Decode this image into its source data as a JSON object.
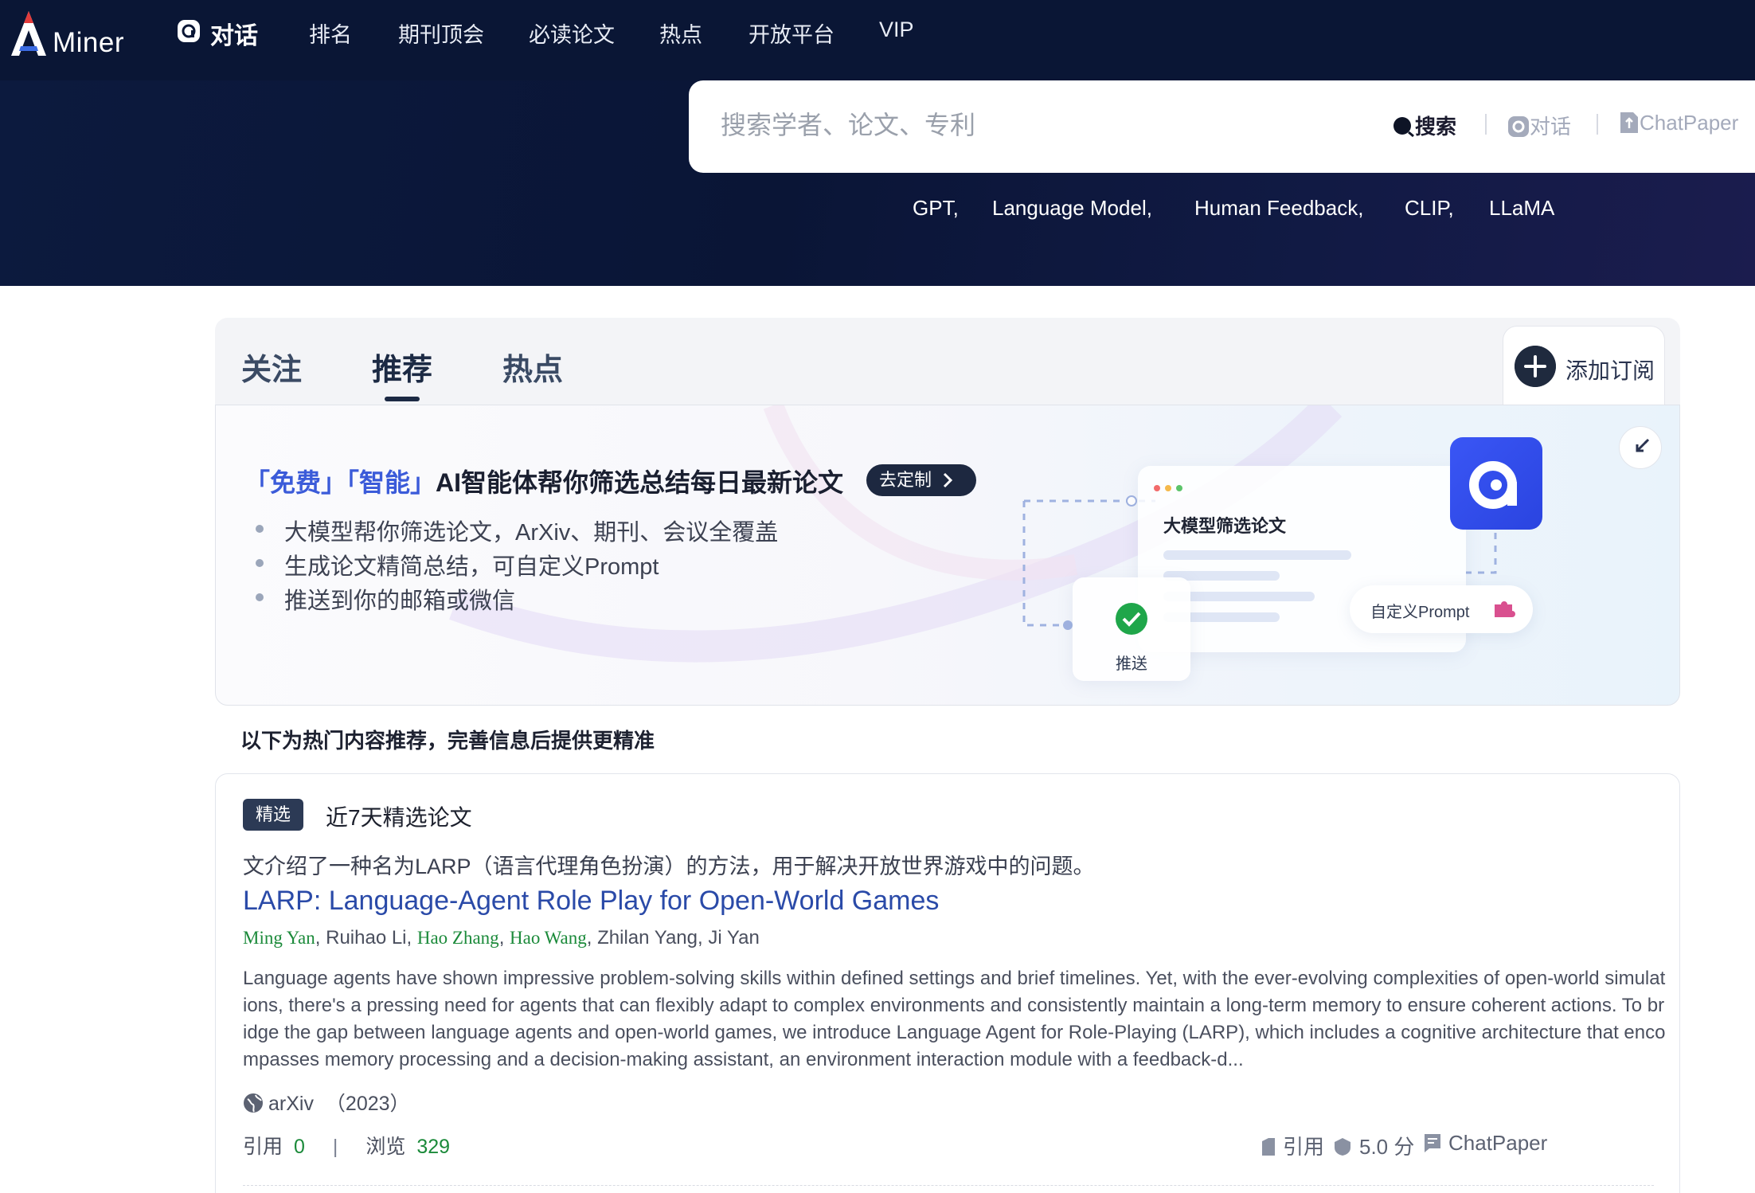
{
  "brand": {
    "logo_text": "Miner"
  },
  "nav": {
    "chat": "对话",
    "items": [
      "排名",
      "期刊顶会",
      "必读论文",
      "热点",
      "开放平台",
      "VIP"
    ]
  },
  "search": {
    "placeholder": "搜索学者、论文、专利",
    "modes": {
      "search": "搜索",
      "chat": "对话",
      "paper": "ChatPaper"
    },
    "keywords": [
      "GPT,",
      "Language Model,",
      "Human Feedback,",
      "CLIP,",
      "LLaMA"
    ]
  },
  "tabs": {
    "items": [
      "关注",
      "推荐",
      "热点"
    ],
    "active": "推荐"
  },
  "subscribe": {
    "label": "添加订阅"
  },
  "promo": {
    "title_accent": "「免费」「智能」",
    "title_rest": "AI智能体帮你筛选总结每日最新论文",
    "customize": "去定制",
    "bullets": [
      "大模型帮你筛选论文，ArXiv、期刊、会议全覆盖",
      "生成论文精简总结，可自定义Prompt",
      "推送到你的邮箱或微信"
    ],
    "illustration": {
      "card_title": "大模型筛选论文",
      "push_label": "推送",
      "prompt_label": "自定义Prompt"
    }
  },
  "hint": "以下为热门内容推荐，完善信息后提供更精准",
  "paper": {
    "badge": "精选",
    "badge_label": "近7天精选论文",
    "summary": "文介绍了一种名为LARP（语言代理角色扮演）的方法，用于解决开放世界游戏中的问题。",
    "title": "LARP: Language-Agent Role Play for Open-World Games",
    "authors": [
      {
        "name": "Ming Yan",
        "linked": true
      },
      {
        "name": "Ruihao Li",
        "linked": false
      },
      {
        "name": "Hao Zhang",
        "linked": true
      },
      {
        "name": "Hao Wang",
        "linked": true
      },
      {
        "name": "Zhilan Yang",
        "linked": false
      },
      {
        "name": "Ji Yan",
        "linked": false
      }
    ],
    "abstract": "Language agents have shown impressive problem-solving skills within defined settings and brief timelines. Yet, with the ever-evolving complexities of open-world simulations, there's a pressing need for agents that can flexibly adapt to complex environments and consistently maintain a long-term memory to ensure coherent actions. To bridge the gap between language agents and open-world games, we introduce Language Agent for Role-Playing (LARP), which includes a cognitive architecture that encompasses memory processing and a decision-making assistant, an environment interaction module with a feedback-d...",
    "venue": "arXiv",
    "year": "（2023）",
    "stats": {
      "cite_label": "引用",
      "cite_count": "0",
      "view_label": "浏览",
      "view_count": "329"
    },
    "actions": {
      "cite": "引用",
      "score": "5.0 分",
      "chatpaper": "ChatPaper"
    }
  },
  "colors": {
    "header_bg": "#0a1635",
    "accent_blue": "#3b5bd9",
    "link_green": "#1b8a3a",
    "title_blue": "#2a4aa8"
  }
}
